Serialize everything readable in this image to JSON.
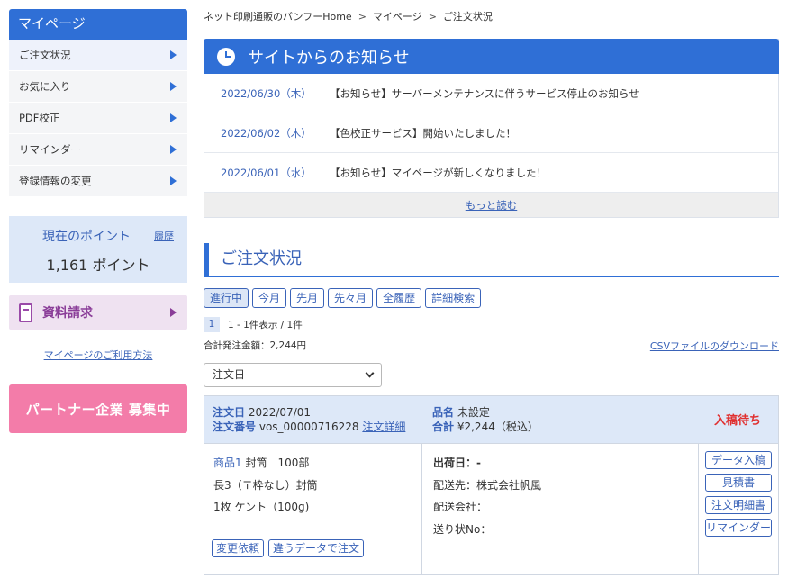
{
  "sidebar": {
    "title": "マイページ",
    "items": [
      {
        "label": "ご注文状況"
      },
      {
        "label": "お気に入り"
      },
      {
        "label": "PDF校正"
      },
      {
        "label": "リマインダー"
      },
      {
        "label": "登録情報の変更"
      }
    ],
    "points": {
      "label": "現在のポイント",
      "history": "履歴",
      "value": "1,161 ポイント"
    },
    "doc_request": "資料請求",
    "howto": "マイページのご利用方法",
    "partner": "パートナー企業 募集中"
  },
  "breadcrumb": [
    "ネット印刷通販のバンフーHome",
    "マイページ",
    "ご注文状況"
  ],
  "breadcrumb_sep": ">",
  "news": {
    "title": "サイトからのお知らせ",
    "items": [
      {
        "date": "2022/06/30（木）",
        "text": "【お知らせ】サーバーメンテナンスに伴うサービス停止のお知らせ"
      },
      {
        "date": "2022/06/02（木）",
        "text": "【色校正サービス】開始いたしました！"
      },
      {
        "date": "2022/06/01（水）",
        "text": "【お知らせ】マイページが新しくなりました！"
      }
    ],
    "more": "もっと読む"
  },
  "orders": {
    "title": "ご注文状況",
    "filters": [
      "進行中",
      "今月",
      "先月",
      "先々月",
      "全履歴",
      "詳細検索"
    ],
    "page": "1",
    "page_info": "1 - 1件表示 / 1件",
    "total": "合計発注金額：2,244円",
    "csv": "CSVファイルのダウンロード",
    "sort": "注文日",
    "order": {
      "date_label": "注文日",
      "date": "2022/07/01",
      "number_label": "注文番号",
      "number": "vos_00000716228",
      "detail_link": "注文詳細",
      "product_label": "品名",
      "product": "未設定",
      "sum_label": "合計",
      "sum": "¥2,244（税込）",
      "status": "入稿待ち",
      "item_label": "商品1",
      "item_line1": "封筒　100部",
      "item_line2": "長3（〒枠なし）封筒",
      "item_line3": "1枚 ケント（100g)",
      "btn_change": "変更依頼",
      "btn_reorder": "違うデータで注文",
      "ship_date": "出荷日：-",
      "ship_to": "配送先：株式会社帆風",
      "carrier": "配送会社：",
      "tracking": "送り状No：",
      "side_buttons": [
        "データ入稿",
        "見積書",
        "注文明細書",
        "リマインダー"
      ]
    }
  },
  "colors": {
    "accent": "#2f6fd6",
    "link": "#3a63b8",
    "status": "#e03030",
    "partner": "#f37ca9"
  }
}
